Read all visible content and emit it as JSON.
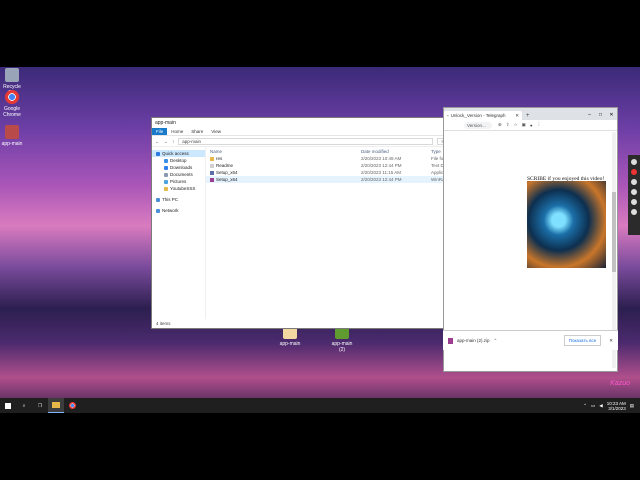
{
  "desktop": {
    "icons": [
      {
        "label": "Recycle Bin",
        "color": "#9aa4b8"
      },
      {
        "label": "Google Chrome",
        "color": "#e53935"
      },
      {
        "label": "app-main",
        "color": "#b84a4a"
      }
    ],
    "taskbar_files": [
      {
        "label": "app-main",
        "color": "#f2d8a0"
      },
      {
        "label": "app-main (2)",
        "color": "#5f9b2f"
      }
    ]
  },
  "explorer": {
    "title": "app-main",
    "ribbon_tabs": [
      "File",
      "Home",
      "Share",
      "View"
    ],
    "path": "app-main",
    "search_placeholder": "Search app-main",
    "nav": [
      {
        "label": "Quick access",
        "icon": "star-icon",
        "color": "#2a7ae2",
        "selected": true,
        "sub": false
      },
      {
        "label": "Desktop",
        "icon": "desktop-icon",
        "color": "#3a8ee6",
        "selected": false,
        "sub": true
      },
      {
        "label": "Downloads",
        "icon": "download-icon",
        "color": "#2f80ed",
        "selected": false,
        "sub": true
      },
      {
        "label": "Documents",
        "icon": "document-icon",
        "color": "#8a9bb0",
        "selected": false,
        "sub": true
      },
      {
        "label": "Pictures",
        "icon": "pictures-icon",
        "color": "#4aa3df",
        "selected": false,
        "sub": true
      },
      {
        "label": "YoutubeSSS",
        "icon": "folder-icon",
        "color": "#e6b84a",
        "selected": false,
        "sub": true
      },
      {
        "label": "This PC",
        "icon": "pc-icon",
        "color": "#4a90d9",
        "selected": false,
        "sub": false
      },
      {
        "label": "Network",
        "icon": "network-icon",
        "color": "#4a90d9",
        "selected": false,
        "sub": false
      }
    ],
    "columns": {
      "name": "Name",
      "date": "Date modified",
      "type": "Type",
      "size": "Size"
    },
    "files": [
      {
        "name": "res",
        "date": "2/20/2023 10:49 AM",
        "type": "File folder",
        "icon": "folder-icon",
        "color": "#e6b84a"
      },
      {
        "name": "Readme",
        "date": "2/20/2023 12:44 PM",
        "type": "Text Document",
        "icon": "text-file-icon",
        "color": "#d0d0d0"
      },
      {
        "name": "Setup_x64",
        "date": "2/20/2023 11:15 AM",
        "type": "Application",
        "icon": "setup-icon",
        "color": "#5a6fa8"
      },
      {
        "name": "Setup_x64",
        "date": "2/20/2023 12:44 PM",
        "type": "WinRAR ZIP archive",
        "icon": "archive-icon",
        "color": "#9c3d8f"
      }
    ],
    "status": "4 items"
  },
  "browser": {
    "tab_title": "Unlock_Version - Telegraph",
    "omnibox": "Version...",
    "body_text": "SCRIBE if you enjoyed this video!",
    "download_file": "app-main (2).zip",
    "show_all": "Показать все"
  },
  "taskbar": {
    "time": "10:23 AM",
    "date": "3/1/2023"
  },
  "signature": "Kazuo"
}
